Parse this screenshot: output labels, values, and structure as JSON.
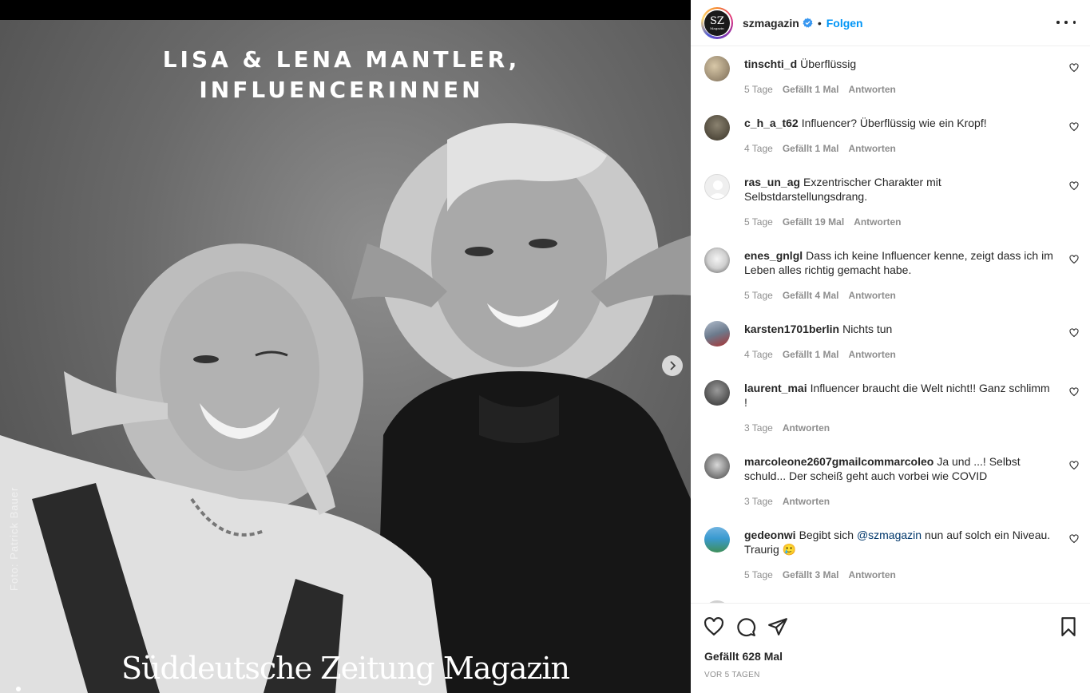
{
  "media": {
    "headline_line1": "LISA & LENA MANTLER,",
    "headline_line2": "INFLUENCERINNEN",
    "photo_credit": "Foto: Patrick Bauer",
    "brand_text": "Süddeutsche Zeitung Magazin",
    "next_icon": "chevron-right-icon"
  },
  "header": {
    "avatar_text": "SZ",
    "avatar_subtext": "Magazin",
    "username": "szmagazin",
    "verified_icon": "verified-badge-icon",
    "separator": "•",
    "follow_label": "Folgen",
    "more_icon": "more-options-icon"
  },
  "comments": [
    {
      "user": "tinschti_d",
      "text": "Überflüssig",
      "age": "5 Tage",
      "likes": "Gefällt 1 Mal",
      "reply": "Antworten"
    },
    {
      "user": "c_h_a_t62",
      "text": "Influencer? Überflüssig wie ein Kropf!",
      "age": "4 Tage",
      "likes": "Gefällt 1 Mal",
      "reply": "Antworten"
    },
    {
      "user": "ras_un_ag",
      "text": "Exzentrischer Charakter mit Selbstdarstellungsdrang.",
      "age": "5 Tage",
      "likes": "Gefällt 19 Mal",
      "reply": "Antworten"
    },
    {
      "user": "enes_gnlgl",
      "text": "Dass ich keine Influencer kenne, zeigt dass ich im Leben alles richtig gemacht habe.",
      "age": "5 Tage",
      "likes": "Gefällt 4 Mal",
      "reply": "Antworten"
    },
    {
      "user": "karsten1701berlin",
      "text": "Nichts tun",
      "age": "4 Tage",
      "likes": "Gefällt 1 Mal",
      "reply": "Antworten"
    },
    {
      "user": "laurent_mai",
      "text": "Influencer braucht die Welt nicht!! Ganz schlimm !",
      "age": "3 Tage",
      "likes": "",
      "reply": "Antworten"
    },
    {
      "user": "marcoleone2607gmailcommarcoleo",
      "text": "Ja und ...! Selbst schuld... Der scheiß geht auch vorbei wie COVID",
      "age": "3 Tage",
      "likes": "",
      "reply": "Antworten"
    },
    {
      "user": "gedeonwi",
      "text_before": "Begibt sich ",
      "mention": "@szmagazin",
      "text_after": " nun auf solch ein Niveau. Traurig 🥲",
      "age": "5 Tage",
      "likes": "Gefällt 3 Mal",
      "reply": "Antworten"
    }
  ],
  "actions": {
    "like_icon": "heart-icon",
    "comment_icon": "comment-icon",
    "share_icon": "share-icon",
    "save_icon": "bookmark-icon",
    "likes_label": "Gefällt 628 Mal",
    "timestamp": "VOR 5 TAGEN"
  },
  "colors": {
    "link_blue": "#0095f6",
    "mention_blue": "#00376b",
    "meta_gray": "#8e8e8e",
    "text": "#262626"
  }
}
